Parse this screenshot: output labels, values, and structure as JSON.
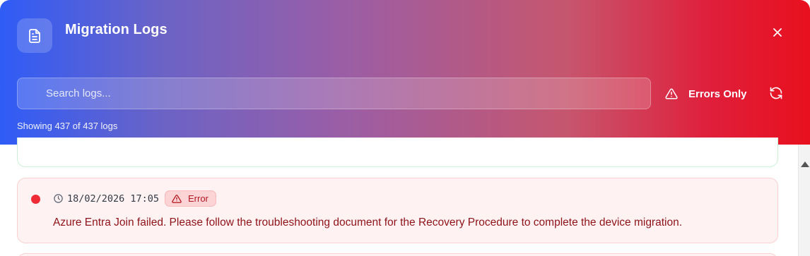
{
  "header": {
    "title": "Migration Logs",
    "title_icon": "document-icon",
    "close_icon": "close-icon"
  },
  "search": {
    "placeholder": "Search logs...",
    "value": ""
  },
  "filters": {
    "errors_only_label": "Errors Only",
    "errors_icon": "warning-icon",
    "refresh_icon": "refresh-icon"
  },
  "summary": {
    "count_text": "Showing 437 of 437 logs"
  },
  "logs": [
    {
      "level": "Error",
      "timestamp": "18/02/2026 17:05",
      "message": "Azure Entra Join failed. Please follow the troubleshooting document for the Recovery Procedure to complete the device migration."
    }
  ],
  "colors": {
    "gradient_start": "#2f5cf7",
    "gradient_end": "#e8101e",
    "error_dot": "#ef2b36",
    "error_text": "#8f1219",
    "error_card_bg": "#fef2f2"
  }
}
